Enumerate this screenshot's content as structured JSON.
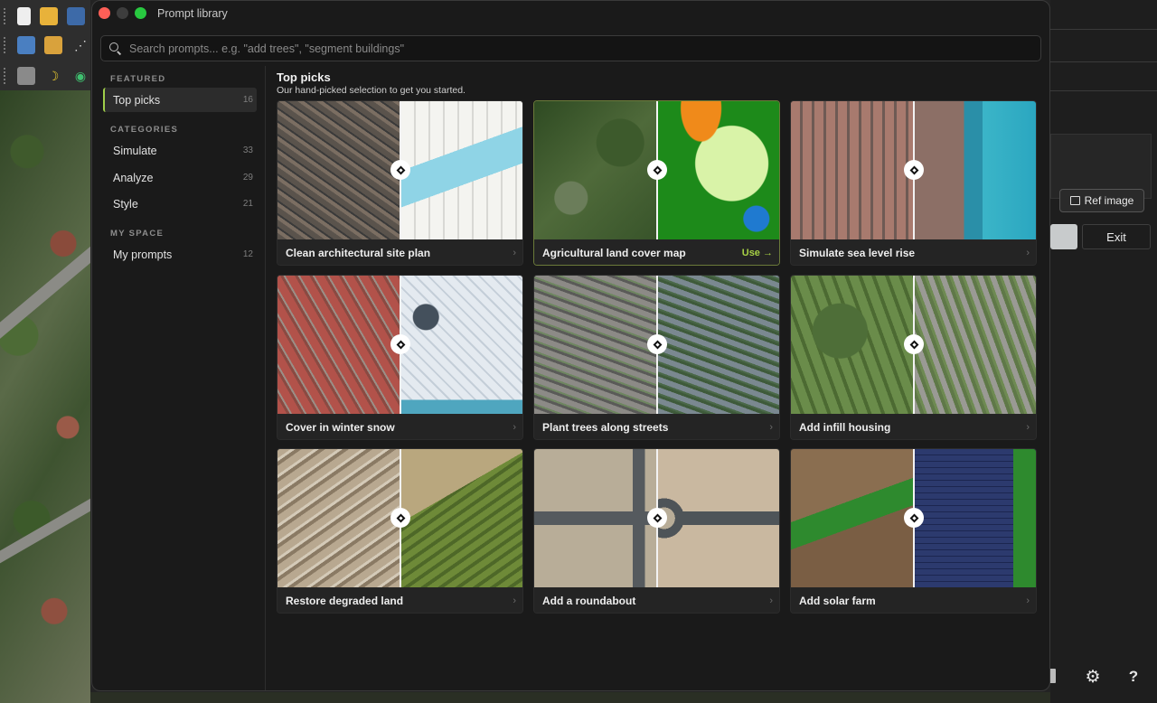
{
  "dialog": {
    "title": "Prompt library",
    "search_placeholder": "Search prompts... e.g. \"add trees\", \"segment buildings\""
  },
  "sidebar": {
    "featured_label": "FEATURED",
    "featured": [
      {
        "label": "Top picks",
        "count": "16"
      }
    ],
    "categories_label": "CATEGORIES",
    "categories": [
      {
        "label": "Simulate",
        "count": "33"
      },
      {
        "label": "Analyze",
        "count": "29"
      },
      {
        "label": "Style",
        "count": "21"
      }
    ],
    "myspace_label": "MY SPACE",
    "myspace": [
      {
        "label": "My prompts",
        "count": "12"
      }
    ]
  },
  "main": {
    "title": "Top picks",
    "subtitle": "Our hand-picked selection to get you started.",
    "cards": [
      {
        "title": "Clean architectural site plan",
        "action": "›"
      },
      {
        "title": "Agricultural land cover map",
        "action": "Use →"
      },
      {
        "title": "Simulate sea level rise",
        "action": "›"
      },
      {
        "title": "Cover in winter snow",
        "action": "›"
      },
      {
        "title": "Plant trees along streets",
        "action": "›"
      },
      {
        "title": "Add infill housing",
        "action": "›"
      },
      {
        "title": "Restore degraded land",
        "action": "›"
      },
      {
        "title": "Add a roundabout",
        "action": "›"
      },
      {
        "title": "Add solar farm",
        "action": "›"
      }
    ]
  },
  "background": {
    "ref_image_label": "Ref image",
    "exit_label": "Exit",
    "help_label": "?"
  },
  "colors": {
    "accent": "#a6cf45",
    "close": "#ff5f57",
    "maximize": "#28c840"
  }
}
